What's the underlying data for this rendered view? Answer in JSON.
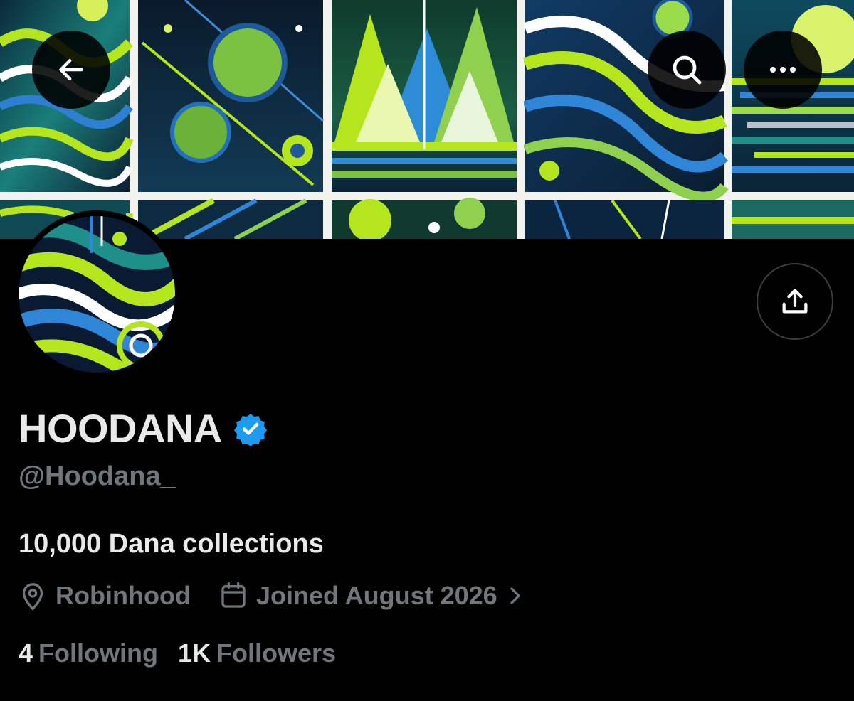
{
  "profile": {
    "display_name": "HOODANA",
    "handle": "@Hoodana_",
    "bio": "10,000 Dana collections",
    "location": "Robinhood",
    "joined": "Joined August 2026",
    "verified": true,
    "verified_color": "#1d9bf0"
  },
  "stats": {
    "following_count": "4",
    "following_label": "Following",
    "followers_count": "1K",
    "followers_label": "Followers"
  },
  "header": {
    "back_icon": "arrow-left-icon",
    "search_icon": "search-icon",
    "more_icon": "more-horizontal-icon",
    "share_icon": "share-upload-icon"
  },
  "colors": {
    "background": "#000000",
    "primary_text": "#e7e9ea",
    "secondary_text": "#71767b",
    "art_green": "#b5e61d",
    "art_blue": "#1f5fa8",
    "art_teal": "#1f8f8a"
  }
}
